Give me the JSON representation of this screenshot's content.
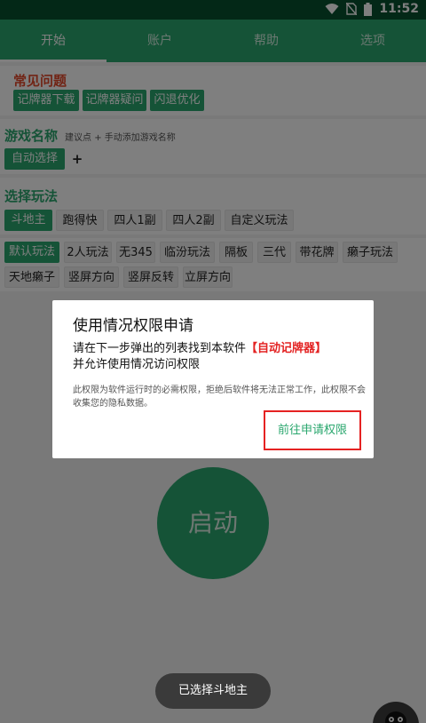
{
  "status": {
    "time": "11:52",
    "icons": [
      "wifi-icon",
      "no-sim-icon",
      "battery-icon"
    ]
  },
  "tabs": [
    {
      "label": "开始"
    },
    {
      "label": "账户"
    },
    {
      "label": "帮助"
    },
    {
      "label": "选项"
    }
  ],
  "faq": {
    "title": "常见问题",
    "buttons": [
      "记牌器下载",
      "记牌器疑问",
      "闪退优化"
    ]
  },
  "game": {
    "title": "游戏名称",
    "hint": "建议点 + 手动添加游戏名称",
    "auto_select": "自动选择",
    "add": "+"
  },
  "play": {
    "title": "选择玩法",
    "modes": [
      "斗地主",
      "跑得快",
      "四人1副",
      "四人2副",
      "自定义玩法"
    ]
  },
  "variants": {
    "row1": [
      "默认玩法",
      "2人玩法",
      "无345",
      "临汾玩法",
      "隔板",
      "三代",
      "带花牌",
      "癞子玩法"
    ],
    "row2": [
      "天地癞子",
      "竖屏方向",
      "竖屏反转",
      "立屏方向"
    ]
  },
  "start_button": "启动",
  "dialog": {
    "title": "使用情况权限申请",
    "message_pre": "请在下一步弹出的列表找到本软件",
    "message_app": "【自动记牌器】",
    "message_post": "并允许使用情况访问权限",
    "note": "此权限为软件运行时的必需权限，拒绝后软件将无法正常工作，此权限不会收集您的隐私数据。",
    "confirm": "前往申请权限"
  },
  "toast": "已选择斗地主",
  "colors": {
    "primary": "#2aa76e",
    "status_bar": "#06512f",
    "highlight": "#e32222",
    "faq_title": "#e3482a"
  }
}
